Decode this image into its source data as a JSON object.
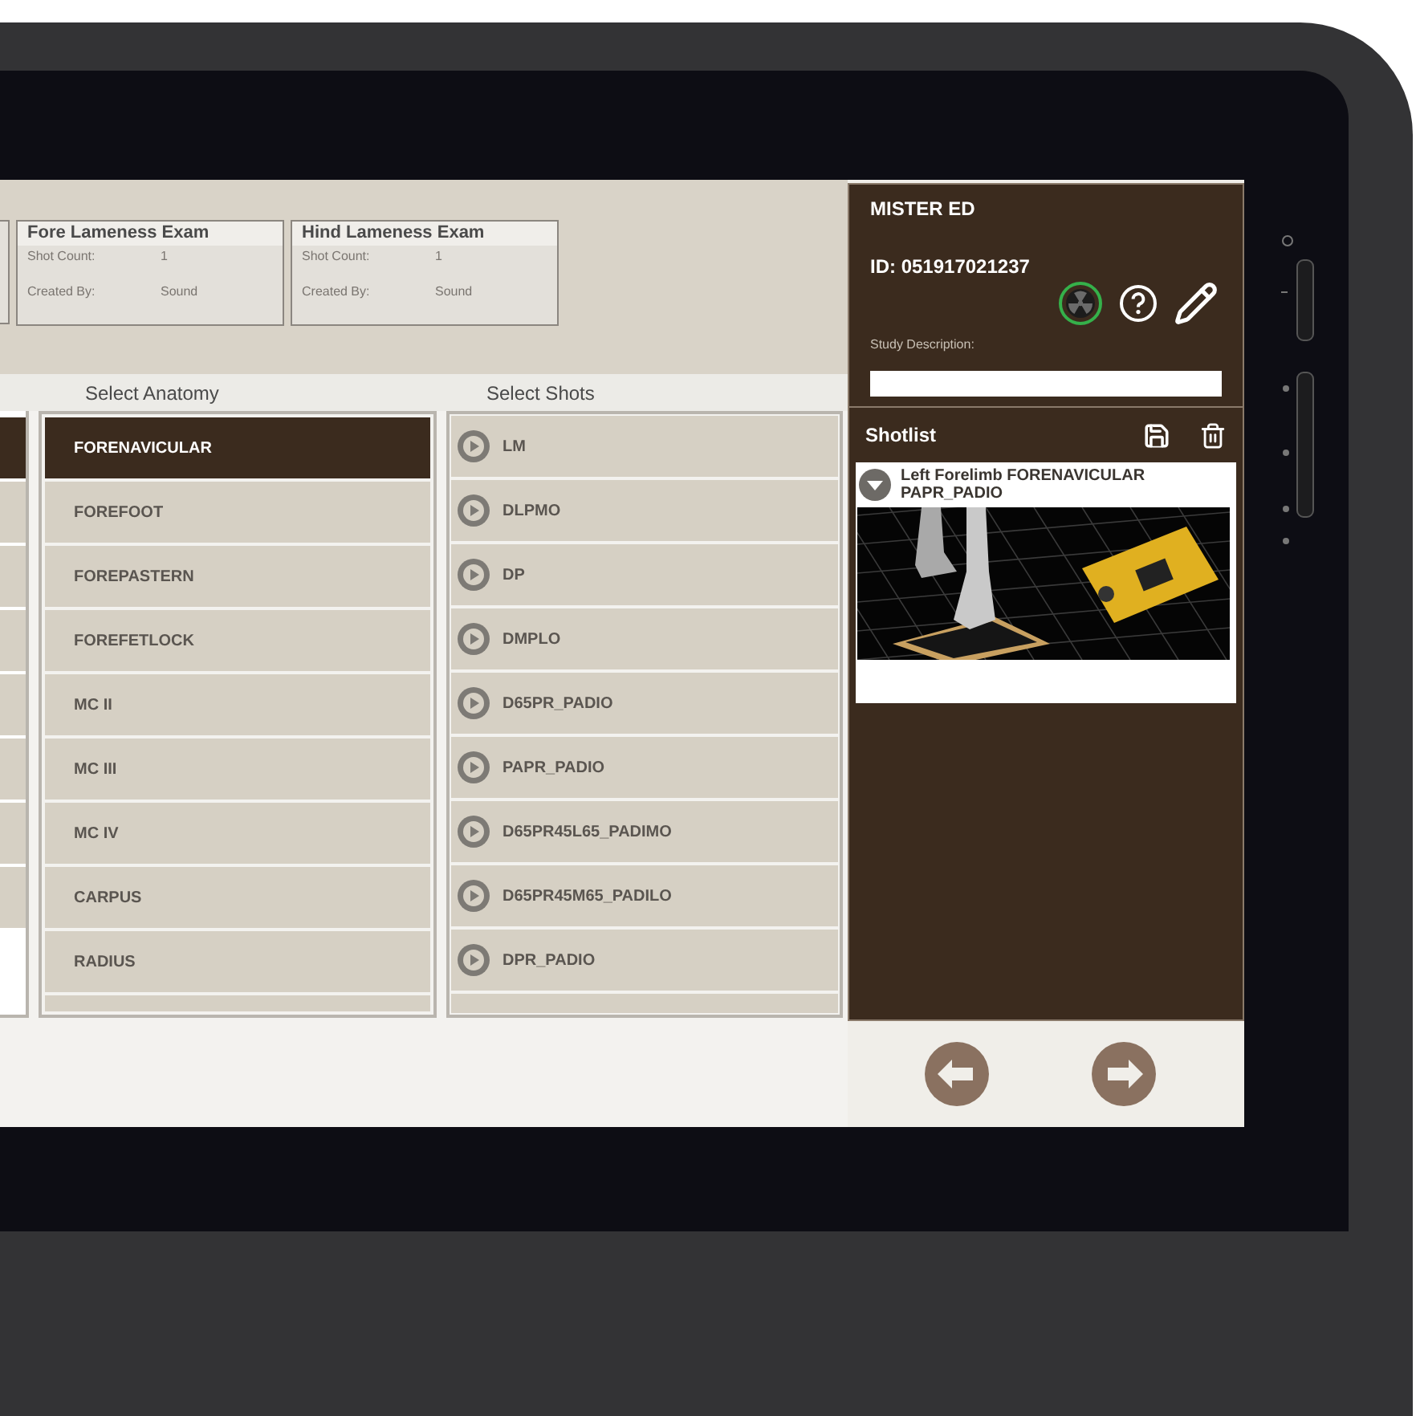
{
  "exam_cards": [
    {
      "title": "Fore Lameness Exam",
      "shot_count_label": "Shot Count:",
      "shot_count": "1",
      "created_by_label": "Created By:",
      "created_by": "Sound"
    },
    {
      "title": "Hind Lameness Exam",
      "shot_count_label": "Shot Count:",
      "shot_count": "1",
      "created_by_label": "Created By:",
      "created_by": "Sound"
    }
  ],
  "region_column": {
    "rows": [
      {
        "selected": true
      },
      {
        "selected": false
      },
      {
        "selected": false
      },
      {
        "selected": false
      },
      {
        "selected": false
      },
      {
        "selected": false
      },
      {
        "selected": false
      },
      {
        "selected": false
      }
    ]
  },
  "anatomy": {
    "heading": "Select Anatomy",
    "items": [
      {
        "label": "FORENAVICULAR",
        "selected": true
      },
      {
        "label": "FOREFOOT",
        "selected": false
      },
      {
        "label": "FOREPASTERN",
        "selected": false
      },
      {
        "label": "FOREFETLOCK",
        "selected": false
      },
      {
        "label": "MC II",
        "selected": false
      },
      {
        "label": "MC III",
        "selected": false
      },
      {
        "label": "MC IV",
        "selected": false
      },
      {
        "label": "CARPUS",
        "selected": false
      },
      {
        "label": "RADIUS",
        "selected": false
      }
    ]
  },
  "shots": {
    "heading": "Select Shots",
    "items": [
      {
        "label": "LM"
      },
      {
        "label": "DLPMO"
      },
      {
        "label": "DP"
      },
      {
        "label": "DMPLO"
      },
      {
        "label": "D65PR_PADIO"
      },
      {
        "label": "PAPR_PADIO"
      },
      {
        "label": "D65PR45L65_PADIMO"
      },
      {
        "label": "D65PR45M65_PADILO"
      },
      {
        "label": "DPR_PADIO"
      }
    ]
  },
  "patient": {
    "name": "MISTER ED",
    "id": "ID: 051917021237",
    "study_description_label": "Study Description:"
  },
  "shotlist": {
    "title": "Shotlist",
    "items": [
      {
        "label": "Left Forelimb FORENAVICULAR PAPR_PADIO",
        "expanded": true
      }
    ]
  }
}
